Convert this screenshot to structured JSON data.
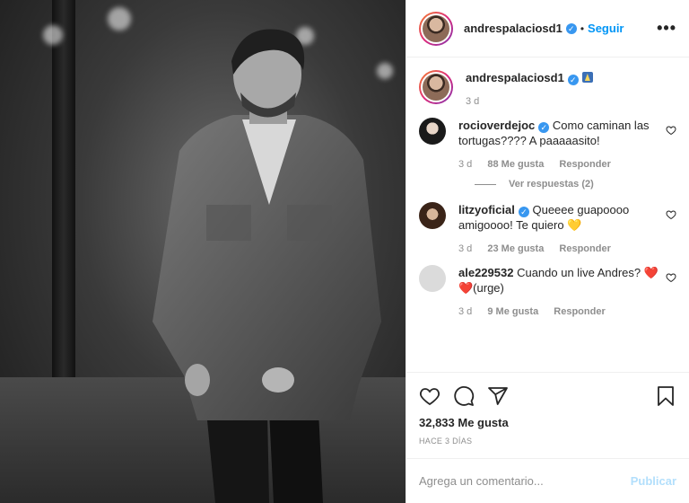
{
  "header": {
    "username": "andrespalaciosd1",
    "dot": "•",
    "follow_label": "Seguir",
    "more_label": "•••"
  },
  "caption": {
    "username": "andrespalaciosd1",
    "time": "3 d"
  },
  "comments": [
    {
      "username": "rocioverdejoc",
      "text": "Como caminan las tortugas???? A paaaaasito!",
      "time": "3 d",
      "likes": "88 Me gusta",
      "reply": "Responder",
      "avatar_color": "#2b2b2b"
    },
    {
      "username": "litzyoficial",
      "text": "Queeee guapoooo amigoooo! Te quiero 💛",
      "time": "3 d",
      "likes": "23 Me gusta",
      "reply": "Responder",
      "avatar_color": "#6b4a3a"
    },
    {
      "username": "ale229532",
      "text": "Cuando un live Andres? ❤️❤️(urge)",
      "time": "3 d",
      "likes": "9 Me gusta",
      "reply": "Responder",
      "avatar_color": "#dbdbdb"
    }
  ],
  "view_replies": "Ver respuestas (2)",
  "likes_count": "32,833 Me gusta",
  "posted_ago": "HACE 3 DÍAS",
  "comment_input": {
    "placeholder": "Agrega un comentario...",
    "value": ""
  },
  "publish_label": "Publicar",
  "colors": {
    "accent": "#0095f6",
    "verified": "#3897f0",
    "muted": "#8e8e8e",
    "publish_disabled": "#b2dffc"
  },
  "icons": [
    "heart-icon",
    "comment-icon",
    "share-icon",
    "bookmark-icon",
    "more-icon",
    "verified-icon"
  ]
}
